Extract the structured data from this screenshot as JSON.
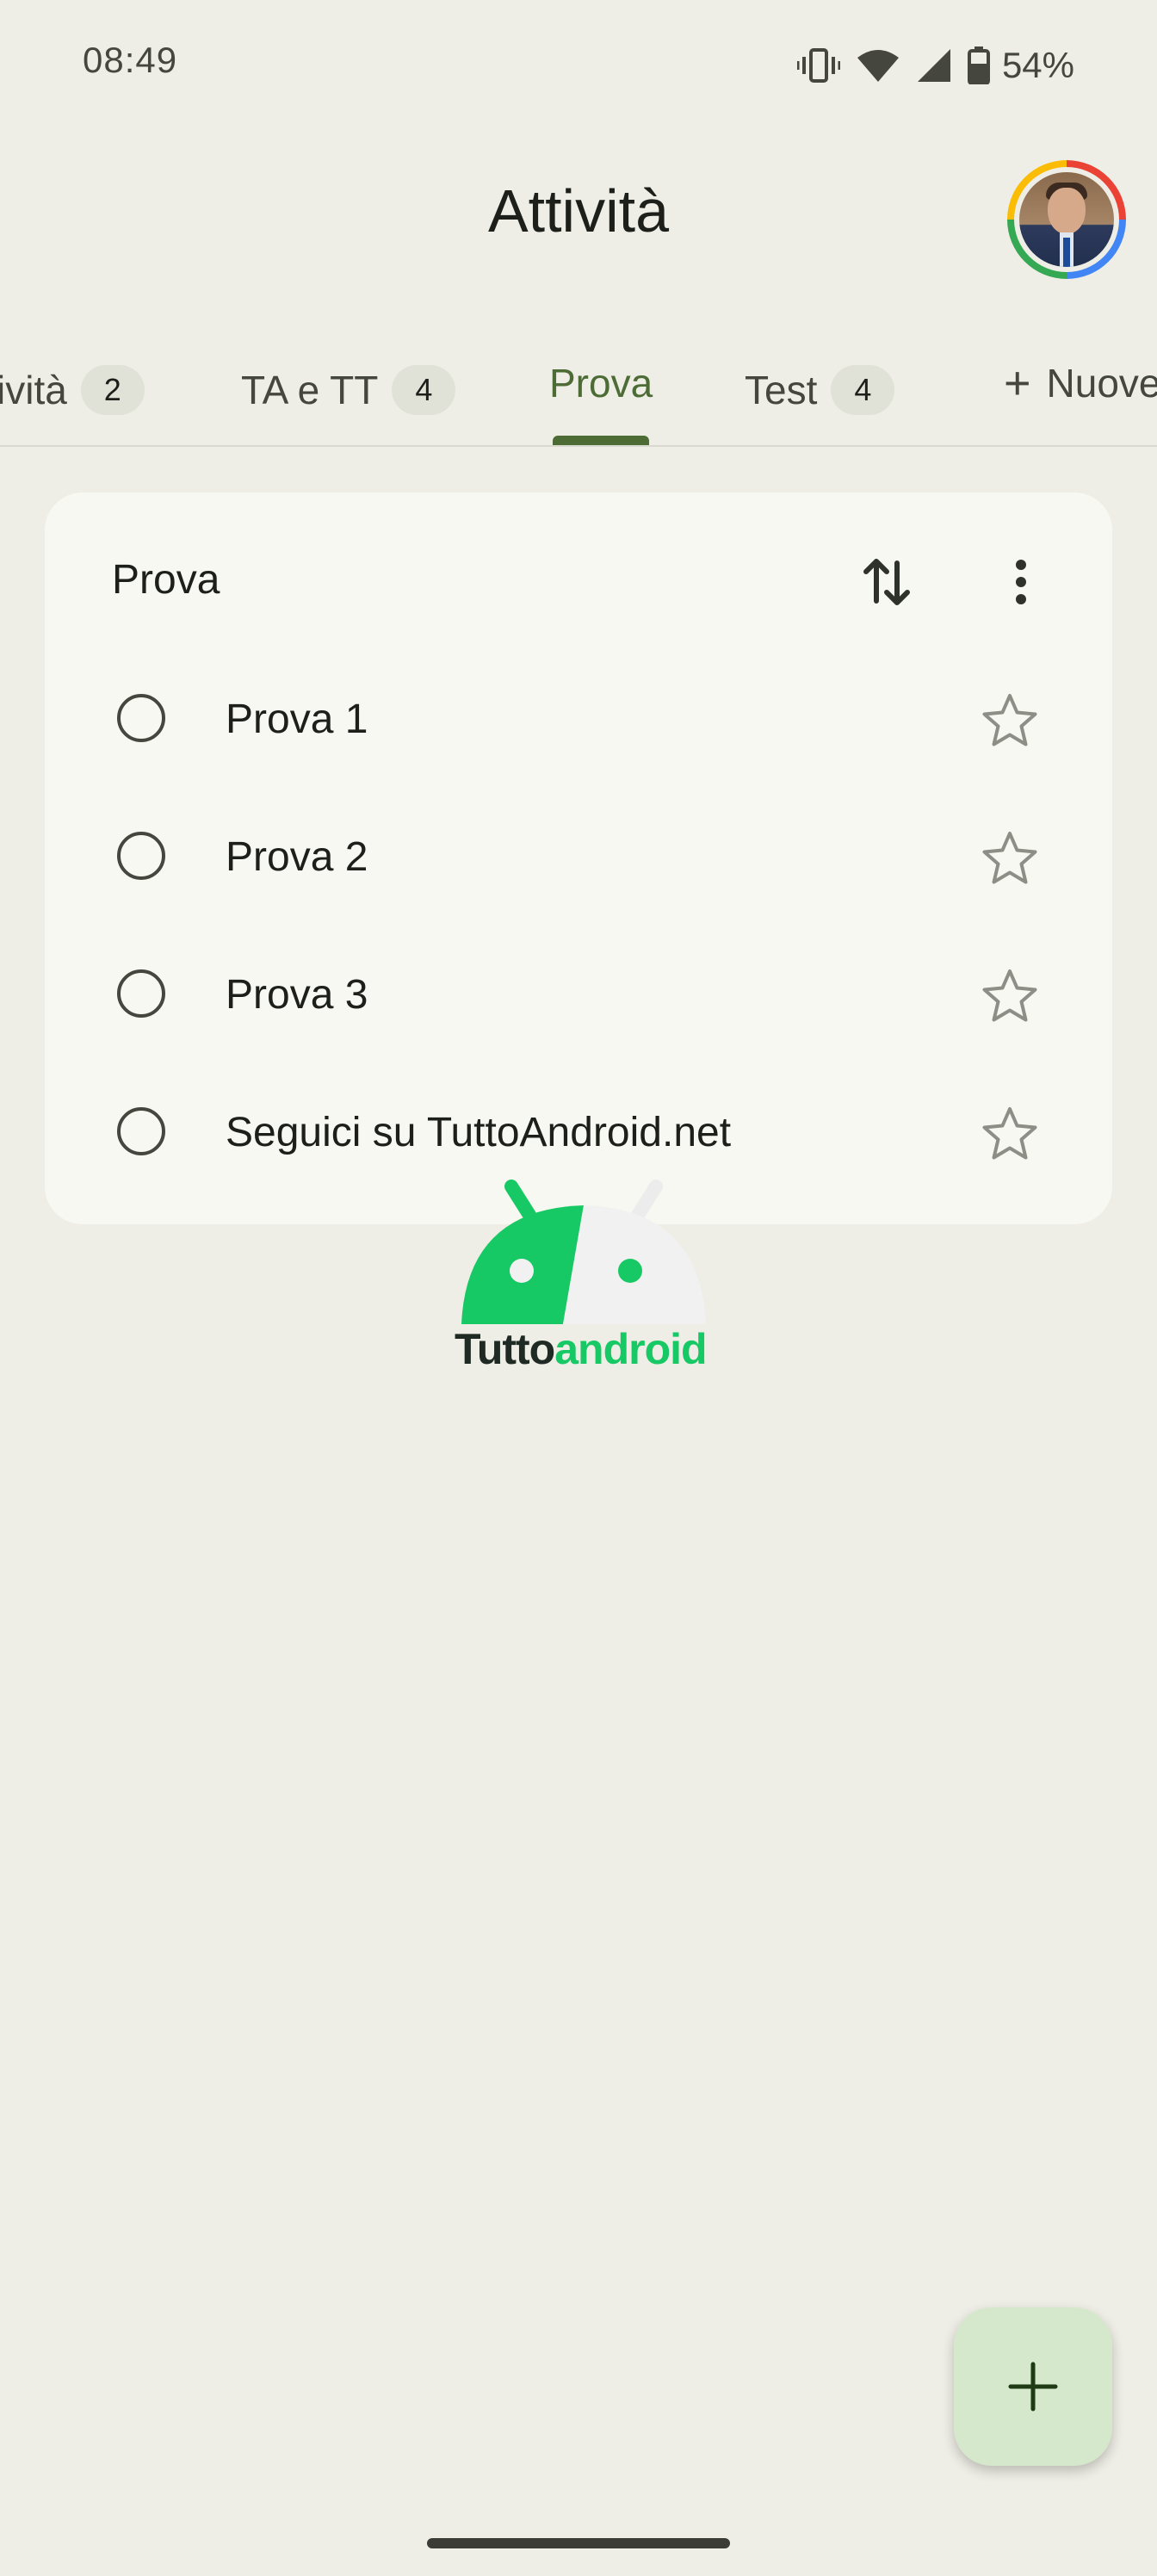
{
  "status_bar": {
    "time": "08:49",
    "battery": "54%"
  },
  "app": {
    "title": "Attività"
  },
  "tabs": [
    {
      "label": "ività",
      "count": "2"
    },
    {
      "label": "TA e TT",
      "count": "4"
    },
    {
      "label": "Prova",
      "active": true
    },
    {
      "label": "Test",
      "count": "4"
    },
    {
      "label": "Nuove"
    }
  ],
  "list": {
    "title": "Prova",
    "tasks": [
      {
        "label": "Prova 1",
        "starred": false
      },
      {
        "label": "Prova 2",
        "starred": false
      },
      {
        "label": "Prova 3",
        "starred": false
      },
      {
        "label": "Seguici su TuttoAndroid.net",
        "starred": false
      }
    ]
  },
  "watermark": {
    "part1": "Tutto",
    "part2": "android"
  },
  "colors": {
    "accent": "#4c6b35",
    "background": "#eeeee6",
    "card": "#f7f8f1",
    "fab": "#d6e8cc"
  },
  "icons": {
    "sort": "sort-arrows-icon",
    "more": "more-vert-icon",
    "check": "radio-circle-icon",
    "star": "star-outline-icon",
    "fab": "add-icon"
  }
}
